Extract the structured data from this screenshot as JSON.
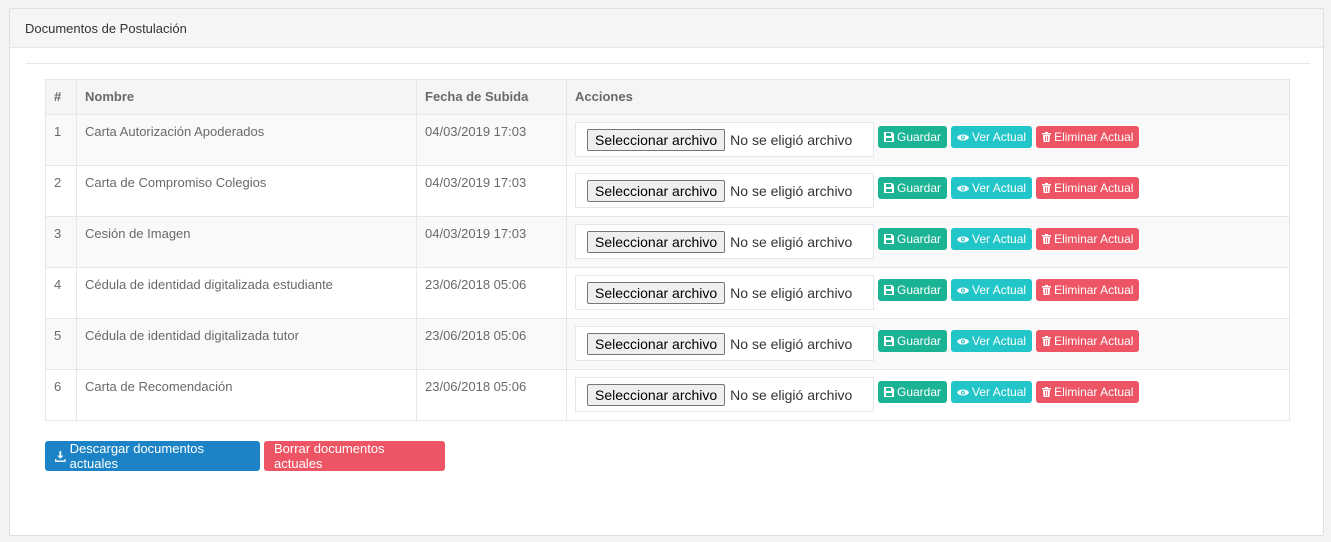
{
  "panel": {
    "title": "Documentos de Postulación"
  },
  "table": {
    "headers": [
      "#",
      "Nombre",
      "Fecha de Subida",
      "Acciones"
    ],
    "rows": [
      {
        "num": "1",
        "name": "Carta Autorización Apoderados",
        "date": "04/03/2019 17:03"
      },
      {
        "num": "2",
        "name": "Carta de Compromiso Colegios",
        "date": "04/03/2019 17:03"
      },
      {
        "num": "3",
        "name": "Cesión de Imagen",
        "date": "04/03/2019 17:03"
      },
      {
        "num": "4",
        "name": "Cédula de identidad digitalizada estudiante",
        "date": "23/06/2018 05:06"
      },
      {
        "num": "5",
        "name": "Cédula de identidad digitalizada tutor",
        "date": "23/06/2018 05:06"
      },
      {
        "num": "6",
        "name": "Carta de Recomendación",
        "date": "23/06/2018 05:06"
      }
    ]
  },
  "actions": {
    "file_button": "Seleccionar archivo",
    "file_status": "No se eligió archivo",
    "save": "Guardar",
    "view": "Ver Actual",
    "delete": "Eliminar Actual"
  },
  "footer": {
    "download": "Descargar documentos actuales",
    "delete_all": "Borrar documentos actuales"
  },
  "colors": {
    "save": "#1ab394",
    "view": "#23c6c8",
    "delete": "#ed5565",
    "download": "#1c84c6"
  },
  "icons": {
    "save": "floppy-disk-icon",
    "view": "eye-icon",
    "delete": "trash-icon",
    "download": "download-icon"
  }
}
